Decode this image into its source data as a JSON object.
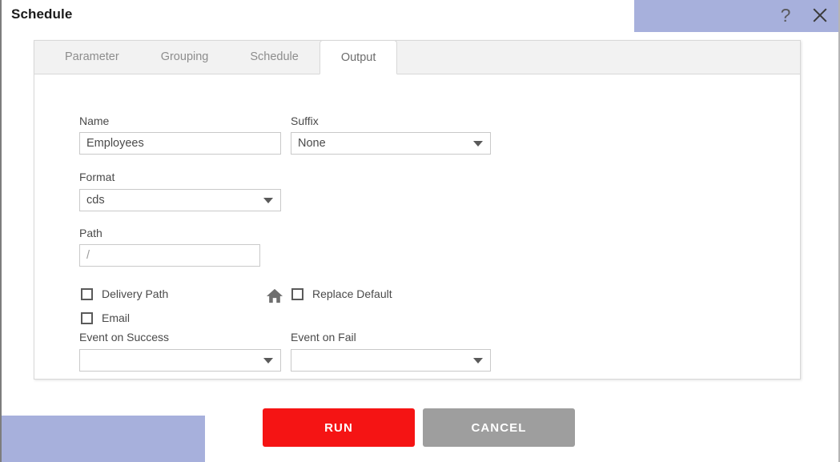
{
  "window": {
    "title": "Schedule",
    "help_icon": "question-mark-icon",
    "close_icon": "close-icon"
  },
  "tabs": [
    {
      "label": "Parameter",
      "active": false
    },
    {
      "label": "Grouping",
      "active": false
    },
    {
      "label": "Schedule",
      "active": false
    },
    {
      "label": "Output",
      "active": true
    }
  ],
  "form": {
    "name": {
      "label": "Name",
      "value": "Employees",
      "placeholder": ""
    },
    "suffix": {
      "label": "Suffix",
      "value": "None"
    },
    "format": {
      "label": "Format",
      "value": "cds"
    },
    "path": {
      "label": "Path",
      "value": "/",
      "home_icon": "home-icon"
    },
    "checkboxes": [
      {
        "label": "Delivery Path",
        "checked": false
      },
      {
        "label": "Email",
        "checked": false
      },
      {
        "label": "Replace Default",
        "checked": false
      }
    ],
    "event_on_success": {
      "label": "Event on Success",
      "value": ""
    },
    "event_on_fail": {
      "label": "Event on Fail",
      "value": ""
    }
  },
  "footer": {
    "run_label": "RUN",
    "cancel_label": "CANCEL"
  },
  "colors": {
    "run_red": "#f51414",
    "cancel_gray": "#9e9e9e",
    "panel_border": "#d8d8d8",
    "tab_strip": "#f2f2f2",
    "pattern_blue": "#9ba6d6"
  }
}
